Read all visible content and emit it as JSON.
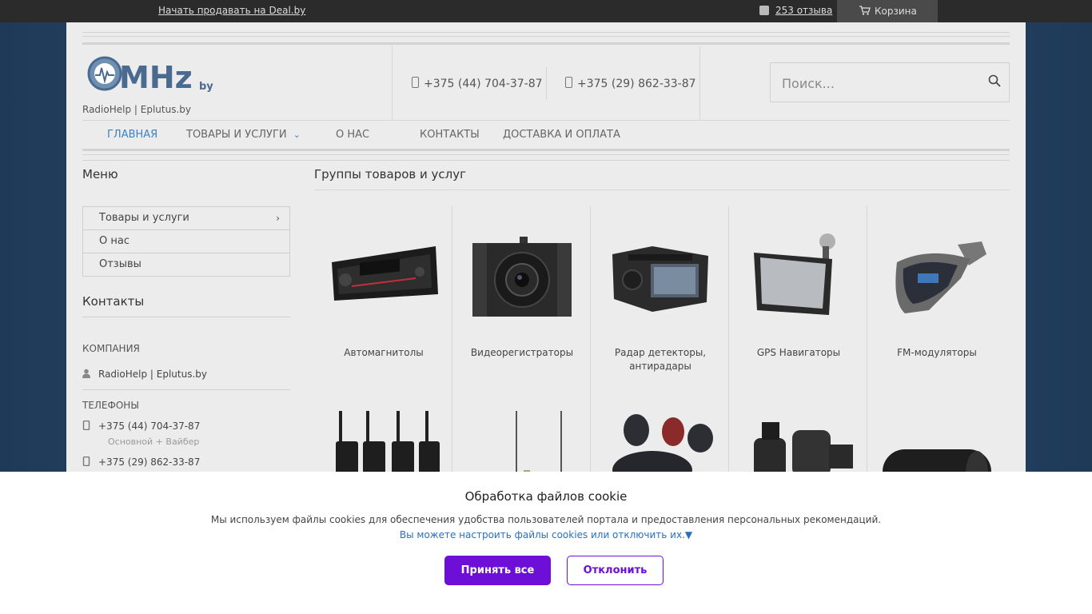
{
  "topbar": {
    "sell_link": "Начать продавать на Deal.by",
    "reviews_link": "253 отзыва",
    "cart_label": "Корзина"
  },
  "header": {
    "logo_text": "MHz",
    "logo_suffix": "by",
    "company_caption": "RadioHelp | Eplutus.by",
    "phone1": "+375 (44) 704-37-87",
    "phone2": "+375 (29) 862-33-87",
    "search_placeholder": "Поиск..."
  },
  "nav": {
    "items": [
      {
        "label": "Главная",
        "active": true
      },
      {
        "label": "Товары и услуги",
        "has_dropdown": true
      },
      {
        "label": "О нас"
      },
      {
        "label": "Контакты"
      },
      {
        "label": "Доставка и оплата"
      }
    ]
  },
  "sidebar": {
    "menu_title": "Меню",
    "menu_items": [
      {
        "label": "Товары и услуги",
        "has_arrow": true
      },
      {
        "label": "О нас"
      },
      {
        "label": "Отзывы"
      }
    ],
    "contacts_title": "Контакты",
    "company_label": "Компания",
    "company_name": "RadioHelp | Eplutus.by",
    "phones_label": "Телефоны",
    "phone1": "+375 (44) 704-37-87",
    "phone1_note": "Основной + Вайбер",
    "phone2": "+375 (29) 862-33-87"
  },
  "main": {
    "title": "Группы товаров и услуг",
    "categories": [
      {
        "label": "Автомагнитолы",
        "icon": "car-radio-icon"
      },
      {
        "label": "Видеорегистраторы",
        "icon": "dashcam-icon"
      },
      {
        "label": "Радар детекторы, антирадары",
        "icon": "radar-detector-icon"
      },
      {
        "label": "GPS Навигаторы",
        "icon": "gps-navigator-icon"
      },
      {
        "label": "FM-модуляторы",
        "icon": "fm-modulator-icon"
      }
    ],
    "second_row_icons": [
      "walkie-talkie-icon",
      "antenna-icon",
      "earbuds-icon",
      "smartwatch-icon",
      "speaker-icon"
    ]
  },
  "cookie": {
    "title": "Обработка файлов cookie",
    "text": "Мы используем файлы cookies для обеспечения удобства пользователей портала и предоставления персональных рекомендаций.",
    "link": "Вы можете настроить файлы cookies или отключить их.▼",
    "accept": "Принять все",
    "decline": "Отклонить"
  },
  "colors": {
    "accent_purple": "#6d0fd6",
    "nav_active": "#3b82c4",
    "topbar": "#2b2b2b"
  }
}
